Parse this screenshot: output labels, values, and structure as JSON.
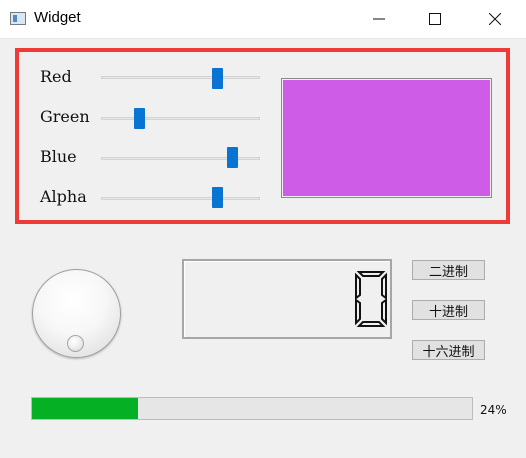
{
  "window": {
    "title": "Widget"
  },
  "sliders": [
    {
      "label": "Red",
      "value": 0.75
    },
    {
      "label": "Green",
      "value": 0.22
    },
    {
      "label": "Blue",
      "value": 0.85
    },
    {
      "label": "Alpha",
      "value": 0.75
    }
  ],
  "preview": {
    "color": "#cf5ce6"
  },
  "colors": {
    "highlight": "#ef3b36",
    "slider_handle": "#0a74d3",
    "progress": "#06b025"
  },
  "lcd": {
    "value": "0"
  },
  "buttons": {
    "binary": "二进制",
    "decimal": "十进制",
    "hex": "十六进制"
  },
  "progress": {
    "value": 24,
    "text": "24%"
  }
}
